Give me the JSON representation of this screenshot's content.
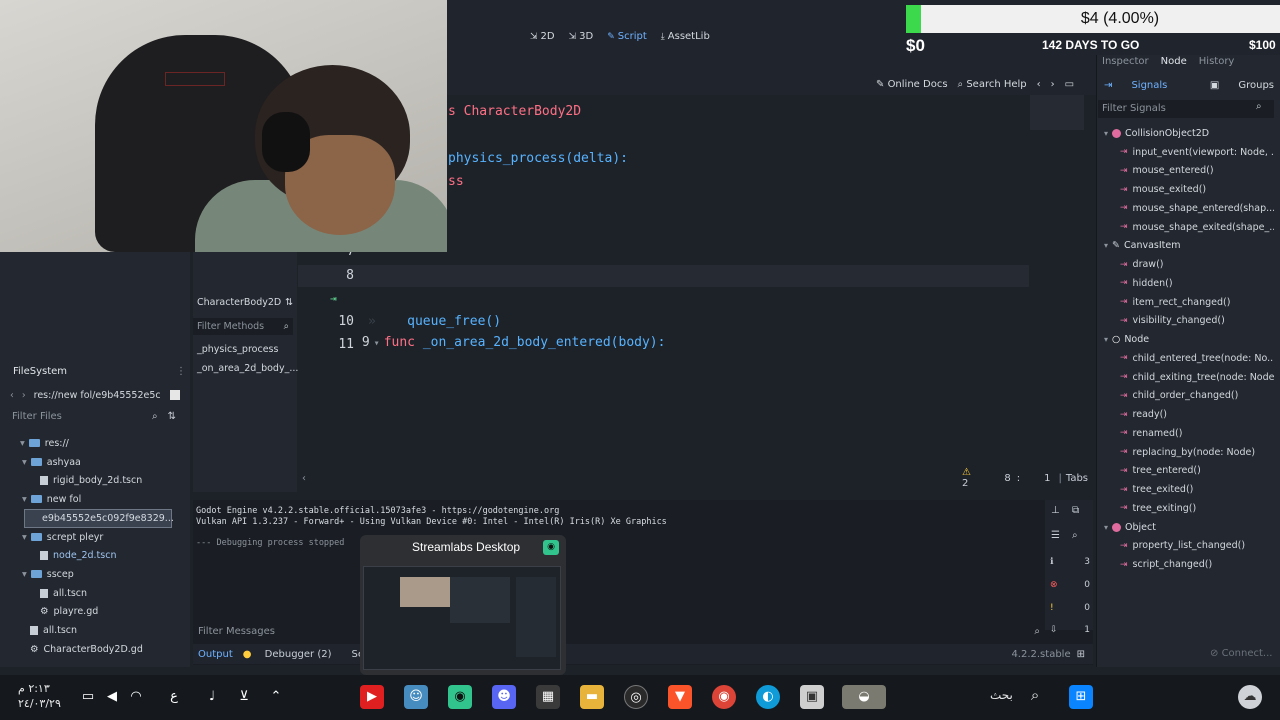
{
  "editor": {
    "modes": [
      {
        "icon": "2d-icon",
        "label": "2D",
        "active": false
      },
      {
        "icon": "3d-icon",
        "label": "3D",
        "active": false
      },
      {
        "icon": "script-icon",
        "label": "Script",
        "active": true
      },
      {
        "icon": "assetlib-icon",
        "label": "AssetLib",
        "active": false
      }
    ],
    "online_docs": "Online Docs",
    "search_help": "Search Help",
    "code_lines": {
      "l_class": "s CharacterBody2D",
      "l_func1": "physics_process(delta):",
      "l_pass": "ss",
      "ln7": "7",
      "ln8": "8",
      "ln9": "9",
      "ln10": "10",
      "ln11": "11",
      "func_kw": "func",
      "func_name": "_on_area_2d_body_entered(body):",
      "queue_free": "queue_free()"
    },
    "status": {
      "warnings": "2",
      "line": "8",
      "col": "1",
      "indent": "Tabs"
    }
  },
  "stream_goal": {
    "amount": "$4 (4.00%)",
    "start": "$0",
    "days": "142 DAYS TO GO",
    "end": "$100",
    "progress_percent": 4
  },
  "inspector": {
    "tabs": [
      "Inspector",
      "Node",
      "History"
    ],
    "active_tab": "Node",
    "signals_tab": "Signals",
    "groups_tab": "Groups",
    "filter_placeholder": "Filter Signals",
    "classes": [
      {
        "name": "CollisionObject2D",
        "signals": [
          "input_event(viewport: Node, ...",
          "mouse_entered()",
          "mouse_exited()",
          "mouse_shape_entered(shap...",
          "mouse_shape_exited(shape_..."
        ]
      },
      {
        "name": "CanvasItem",
        "signals": [
          "draw()",
          "hidden()",
          "item_rect_changed()",
          "visibility_changed()"
        ]
      },
      {
        "name": "Node",
        "signals": [
          "child_entered_tree(node: No...",
          "child_exiting_tree(node: Node)",
          "child_order_changed()",
          "ready()",
          "renamed()",
          "replacing_by(node: Node)",
          "tree_entered()",
          "tree_exited()",
          "tree_exiting()"
        ]
      },
      {
        "name": "Object",
        "signals": [
          "property_list_changed()",
          "script_changed()"
        ]
      }
    ],
    "connect": "Connect..."
  },
  "filesystem": {
    "title": "FileSystem",
    "path": "res://new fol/e9b45552e5c",
    "filter_placeholder": "Filter Files",
    "tree": [
      {
        "label": "res://",
        "type": "folder",
        "indent": 0
      },
      {
        "label": "ashyaa",
        "type": "folder",
        "indent": 1
      },
      {
        "label": "rigid_body_2d.tscn",
        "type": "file",
        "indent": 2
      },
      {
        "label": "new fol",
        "type": "folder",
        "indent": 1
      },
      {
        "label": "e9b45552e5c092f9e8329...",
        "type": "file",
        "indent": 2,
        "selected": true
      },
      {
        "label": "scrept pleyr",
        "type": "folder",
        "indent": 1
      },
      {
        "label": "node_2d.tscn",
        "type": "file",
        "indent": 2
      },
      {
        "label": "sscep",
        "type": "folder",
        "indent": 1
      },
      {
        "label": "all.tscn",
        "type": "file",
        "indent": 2
      },
      {
        "label": "playre.gd",
        "type": "file",
        "indent": 2
      },
      {
        "label": "all.tscn",
        "type": "file",
        "indent": 1
      },
      {
        "label": "CharacterBody2D.gd",
        "type": "file",
        "indent": 1
      }
    ]
  },
  "methods": {
    "header": "CharacterBody2D",
    "filter_placeholder": "Filter Methods",
    "items": [
      "_physics_process",
      "_on_area_2d_body_..."
    ]
  },
  "output": {
    "lines": [
      "Godot Engine v4.2.2.stable.official.15073afe3 - https://godotengine.org",
      "Vulkan API 1.3.237 - Forward+ - Using Vulkan Device #0: Intel - Intel(R) Iris(R) Xe Graphics"
    ],
    "stopped": "--- Debugging process stopped",
    "counts": [
      "3",
      "0",
      "0",
      "1"
    ],
    "filter_placeholder": "Filter Messages",
    "tabs": [
      "Output",
      "Debugger (2)",
      "Search R"
    ],
    "version": "4.2.2.stable"
  },
  "thumbnail": {
    "title": "Streamlabs Desktop"
  },
  "taskbar": {
    "time": "٢:١٣ م",
    "date": "٢٤/٠٣/٢٩",
    "search": "بحث",
    "lang": "ع"
  }
}
